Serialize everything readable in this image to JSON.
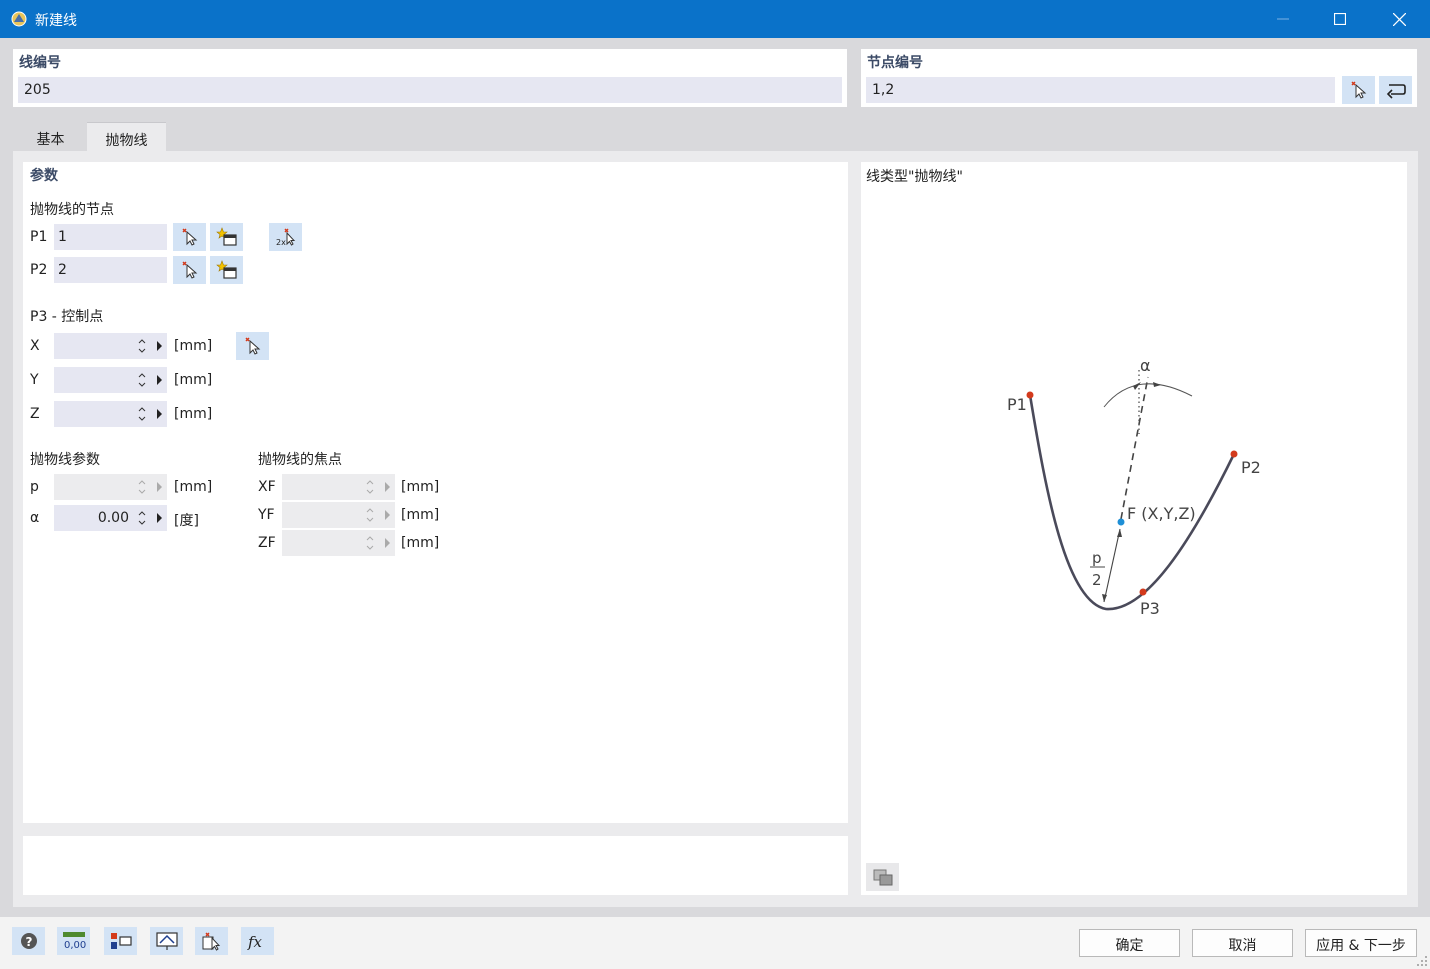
{
  "window": {
    "title": "新建线"
  },
  "line_no": {
    "label": "线编号",
    "value": "205"
  },
  "node_no": {
    "label": "节点编号",
    "value": "1,2"
  },
  "tabs": [
    {
      "label": "基本"
    },
    {
      "label": "抛物线"
    }
  ],
  "params": {
    "heading": "参数",
    "nodes_heading": "抛物线的节点",
    "p1": {
      "label": "P1",
      "value": "1"
    },
    "p2": {
      "label": "P2",
      "value": "2"
    },
    "p3_heading": "P3 - 控制点",
    "x": {
      "label": "X",
      "value": "",
      "unit": "[mm]"
    },
    "y": {
      "label": "Y",
      "value": "",
      "unit": "[mm]"
    },
    "z": {
      "label": "Z",
      "value": "",
      "unit": "[mm]"
    },
    "parab_heading": "抛物线参数",
    "p": {
      "label": "p",
      "value": "",
      "unit": "[mm]"
    },
    "alpha": {
      "label": "α",
      "value": "0.00",
      "unit": "[度]"
    },
    "focus_heading": "抛物线的焦点",
    "xf": {
      "label": "XF",
      "value": "",
      "unit": "[mm]"
    },
    "yf": {
      "label": "YF",
      "value": "",
      "unit": "[mm]"
    },
    "zf": {
      "label": "ZF",
      "value": "",
      "unit": "[mm]"
    }
  },
  "diagram": {
    "heading": "线类型\"抛物线\"",
    "p1": "P1",
    "p2": "P2",
    "p3": "P3",
    "focus": "F (X,Y,Z)",
    "p_num": "p",
    "p_den": "2",
    "alpha": "α"
  },
  "buttons": {
    "ok": "确定",
    "cancel": "取消",
    "apply_next": "应用 & 下一步"
  },
  "colors": {
    "titlebar": "#0a72c9",
    "input_bg": "#e6e7f2",
    "icon_btn_bg": "#d3e3f5",
    "node_red": "#d33a1c",
    "focus_blue": "#1e8fd6"
  }
}
